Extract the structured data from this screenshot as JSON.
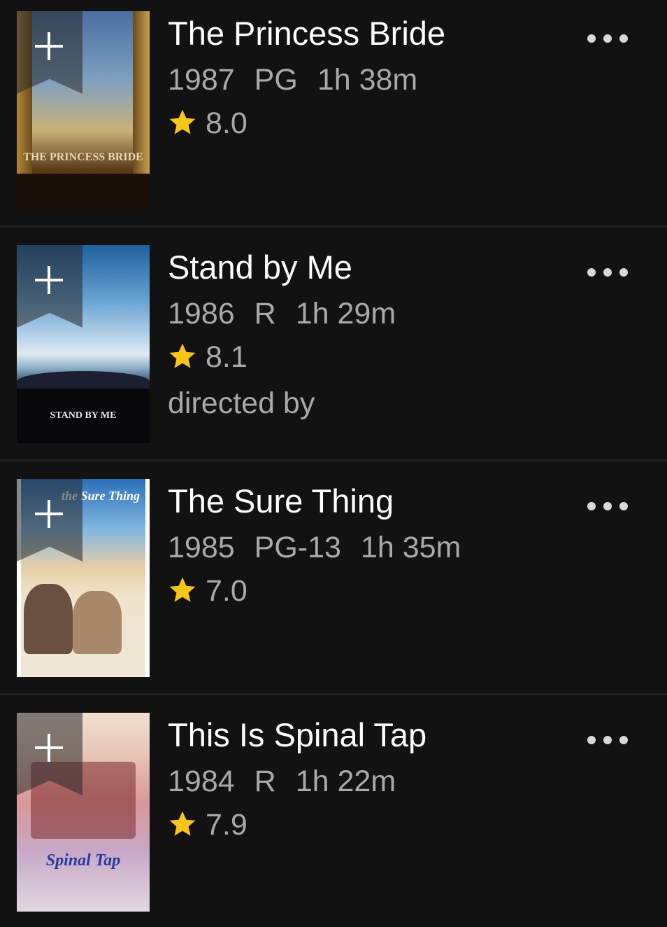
{
  "movies": [
    {
      "title": "The Princess Bride",
      "year": "1987",
      "rating": "PG",
      "runtime": "1h 38m",
      "score": "8.0",
      "extra": "",
      "poster_caption": "THE PRINCESS BRIDE"
    },
    {
      "title": "Stand by Me",
      "year": "1986",
      "rating": "R",
      "runtime": "1h 29m",
      "score": "8.1",
      "extra": "directed by",
      "poster_caption": "STAND BY ME"
    },
    {
      "title": "The Sure Thing",
      "year": "1985",
      "rating": "PG-13",
      "runtime": "1h 35m",
      "score": "7.0",
      "extra": "",
      "poster_caption": "the Sure Thing"
    },
    {
      "title": "This Is Spinal Tap",
      "year": "1984",
      "rating": "R",
      "runtime": "1h 22m",
      "score": "7.9",
      "extra": "",
      "poster_caption": "Spinal Tap"
    }
  ],
  "icons": {
    "add": "plus-icon",
    "star": "star-icon",
    "more": "more-options-icon"
  },
  "colors": {
    "background": "#121212",
    "title": "#ffffff",
    "meta": "#a9a9a9",
    "star": "#f5c518"
  }
}
